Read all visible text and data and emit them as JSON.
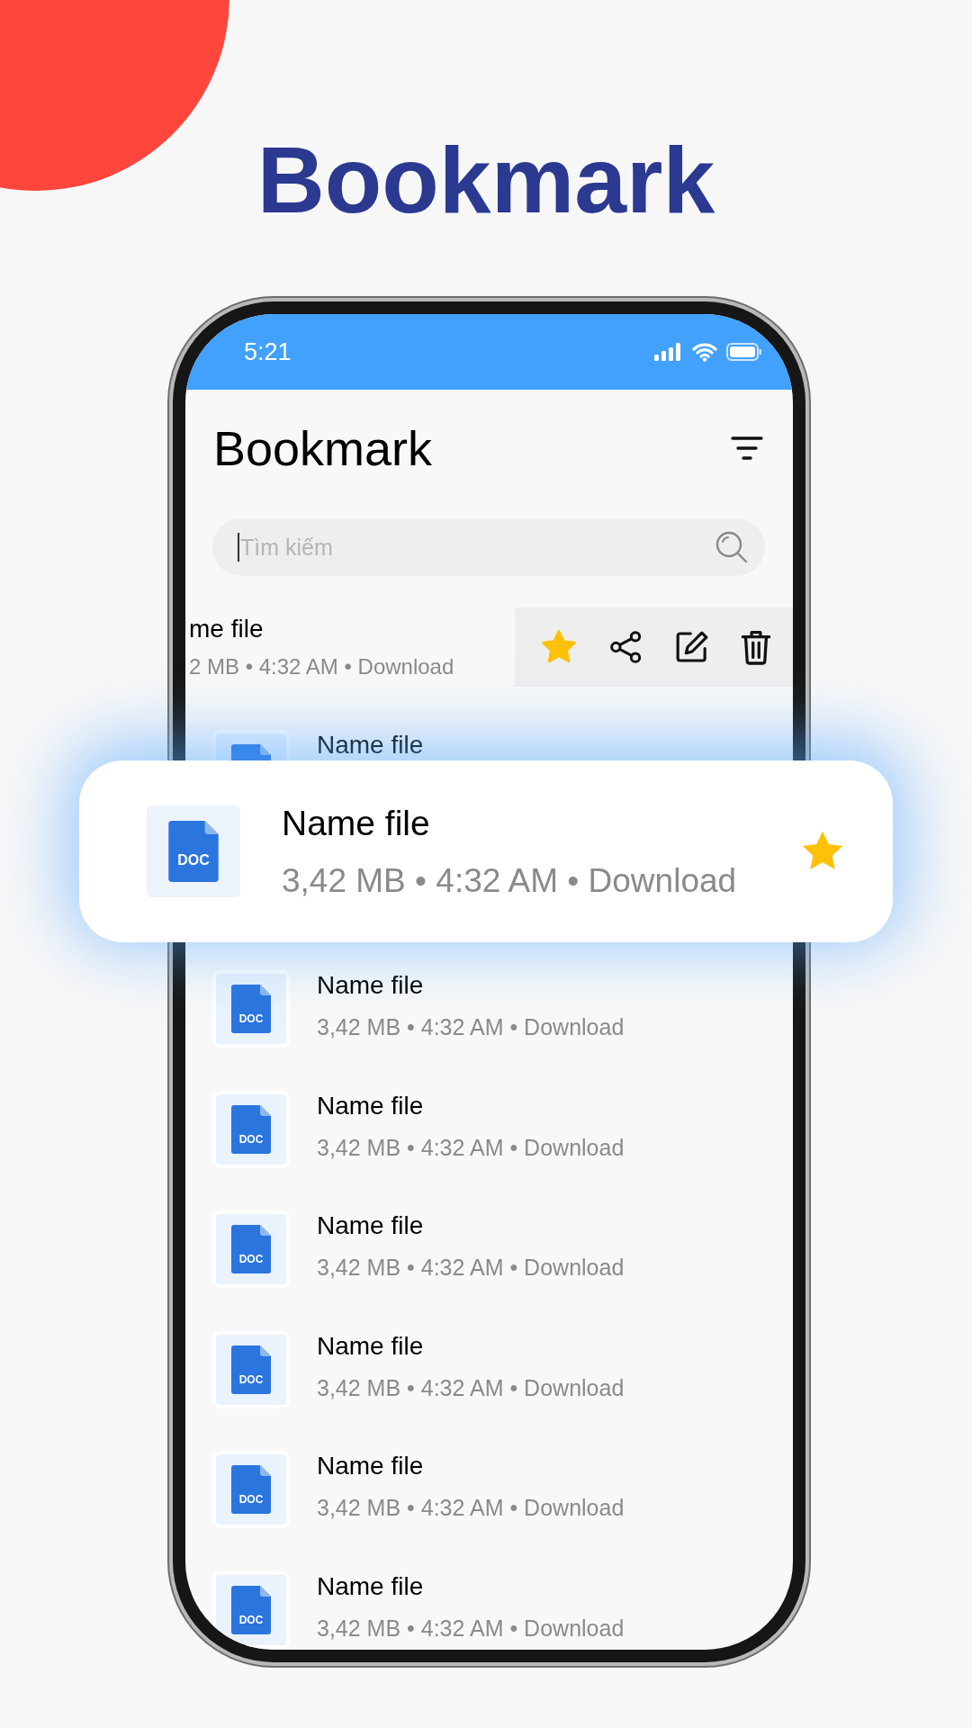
{
  "headline": "Bookmark",
  "status_bar": {
    "time": "5:21"
  },
  "header": {
    "title": "Bookmark"
  },
  "search": {
    "placeholder": "Tìm kiếm"
  },
  "swiped_item": {
    "title": "me file",
    "meta": "2 MB • 4:32 AM • Download",
    "starred": true
  },
  "files": [
    {
      "title": "Name file"
    },
    {
      "title": "Name file",
      "type": "DOC",
      "meta": "3,42 MB • 4:32 AM • Download"
    },
    {
      "title": "Name file",
      "type": "DOC",
      "meta": "3,42 MB • 4:32 AM • Download"
    },
    {
      "title": "Name file",
      "type": "DOC",
      "meta": "3,42 MB • 4:32 AM • Download"
    },
    {
      "title": "Name file",
      "type": "DOC",
      "meta": "3,42 MB • 4:32 AM • Download"
    },
    {
      "title": "Name file",
      "type": "DOC",
      "meta": "3,42 MB • 4:32 AM • Download"
    },
    {
      "title": "Name file",
      "type": "DOC",
      "meta": "3,42 MB • 4:32 AM • Download"
    }
  ],
  "highlighted_file": {
    "title": "Name file",
    "type": "DOC",
    "meta": "3,42 MB • 4:32 AM • Download",
    "starred": true
  }
}
